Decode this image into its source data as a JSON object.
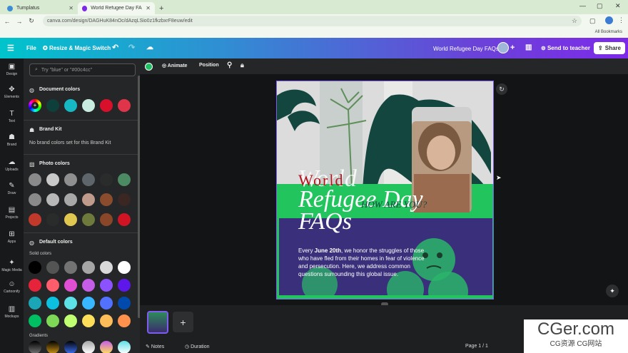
{
  "browser": {
    "tabs": [
      {
        "label": "Tumplatus"
      },
      {
        "label": "World Refugee Day FAQs - Inst"
      }
    ],
    "url": "canva.com/design/DAGHuK84nOc/dAzqLSio0z1fkzbxrF8euw/edit",
    "bookmarks_label": "All Bookmarks"
  },
  "header": {
    "file": "File",
    "resize": "Resize & Magic Switch",
    "doc_title": "World Refugee Day FAQs",
    "send_teacher": "Send to teacher",
    "share": "Share"
  },
  "rail": [
    {
      "label": "Design",
      "icon": "▣"
    },
    {
      "label": "Elements",
      "icon": "✥"
    },
    {
      "label": "Text",
      "icon": "T"
    },
    {
      "label": "Brand",
      "icon": "☗"
    },
    {
      "label": "Uploads",
      "icon": "☁"
    },
    {
      "label": "Draw",
      "icon": "✎"
    },
    {
      "label": "Projects",
      "icon": "▤"
    },
    {
      "label": "Apps",
      "icon": "⊞"
    },
    {
      "label": "Magic Media",
      "icon": "✦"
    },
    {
      "label": "Cartoonify",
      "icon": "☺"
    },
    {
      "label": "Mockups",
      "icon": "▥"
    }
  ],
  "panel": {
    "search_placeholder": "Try \"blue\" or \"#00c4cc\"",
    "document_colors_title": "Document colors",
    "document_colors": [
      "#0e3f3b",
      "#16b9c3",
      "#c8ece0",
      "#d8102b",
      "#e0344a"
    ],
    "brand_kit_title": "Brand Kit",
    "brand_kit_text": "No brand colors set for this Brand Kit",
    "photo_colors_title": "Photo colors",
    "photo_colors": [
      [
        "#c9c9c9",
        "#8f8f8f",
        "#5e666b",
        "#2a2c2b",
        "#4c8a63"
      ],
      [
        "#b8b8b8",
        "#a8a8a8",
        "#c09a8b",
        "#8b4c2e",
        "#3a2622"
      ],
      [
        "#2a2c2b",
        "#e0c750",
        "#6d7a3c",
        "#8a4628",
        "#d01424"
      ]
    ],
    "default_colors_title": "Default colors",
    "solid_colors_label": "Solid colors",
    "solid_colors": [
      [
        "#000000",
        "#545454",
        "#737373",
        "#a6a6a6",
        "#d9d9d9",
        "#ffffff"
      ],
      [
        "#e5243b",
        "#ff5c6c",
        "#e04fd1",
        "#c55de8",
        "#8c52ff",
        "#5e17eb"
      ],
      [
        "#1aa6b7",
        "#0cc0df",
        "#5ce1e6",
        "#38b6ff",
        "#5271ff",
        "#004aad"
      ],
      [
        "#00bf63",
        "#7ed957",
        "#c1ff72",
        "#ffde59",
        "#ffbd59",
        "#ff914d"
      ]
    ],
    "gradients_label": "Gradients"
  },
  "toolbar": {
    "animate": "Animate",
    "position": "Position"
  },
  "design": {
    "title_line1": "World",
    "title_line2": "Refugee Day",
    "title_line3": "FAQs",
    "script_text": "HOW ARE YOU?",
    "body_pre": "Every ",
    "body_bold": "June 20th",
    "body_post": ", we honor the struggles of those who have fled from their homes in fear of violence and persecution. Here, we address common questions surrounding this global issue.",
    "colors": {
      "green": "#22c45e",
      "purple": "#3a2f7a",
      "dark": "#13463f"
    }
  },
  "footer": {
    "notes": "Notes",
    "duration": "Duration",
    "page": "Page 1 / 1"
  },
  "watermark": {
    "big": "CGer.com",
    "small": "CG资源 CG网站"
  }
}
